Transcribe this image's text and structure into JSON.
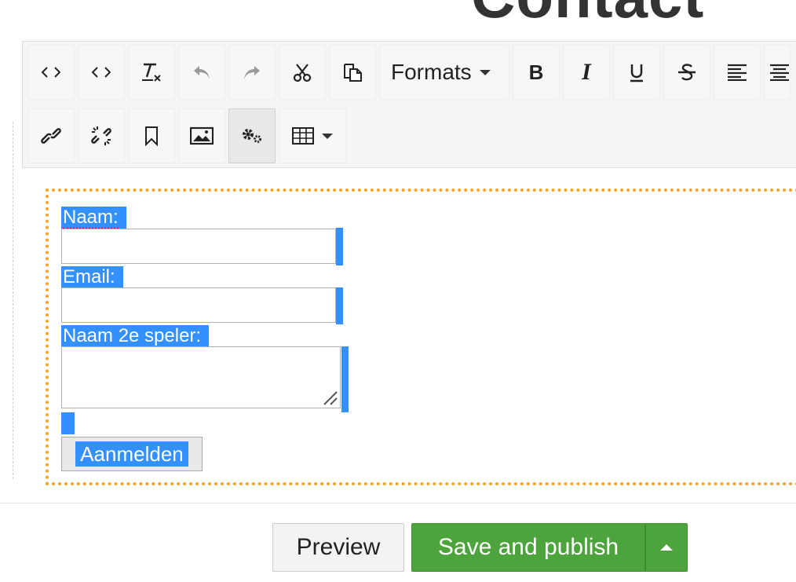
{
  "page": {
    "title": "Contact"
  },
  "toolbar": {
    "formats_label": "Formats",
    "row1": [
      {
        "name": "source-code-button",
        "icon": "code-icon"
      },
      {
        "name": "code-button",
        "icon": "code-icon"
      },
      {
        "name": "clear-formatting-button",
        "icon": "clear-format-icon"
      },
      {
        "name": "undo-button",
        "icon": "undo-icon"
      },
      {
        "name": "redo-button",
        "icon": "redo-icon"
      },
      {
        "name": "cut-button",
        "icon": "scissors-icon"
      },
      {
        "name": "paste-button",
        "icon": "paste-icon"
      },
      {
        "name": "formats-dropdown",
        "icon": "chevron-down-icon"
      },
      {
        "name": "bold-button",
        "icon": "bold-icon"
      },
      {
        "name": "italic-button",
        "icon": "italic-icon"
      },
      {
        "name": "underline-button",
        "icon": "underline-icon"
      },
      {
        "name": "strikethrough-button",
        "icon": "strikethrough-icon"
      },
      {
        "name": "align-left-button",
        "icon": "align-left-icon"
      },
      {
        "name": "align-center-button",
        "icon": "align-center-icon"
      }
    ],
    "row2": [
      {
        "name": "insert-link-button",
        "icon": "link-icon"
      },
      {
        "name": "remove-link-button",
        "icon": "unlink-icon"
      },
      {
        "name": "anchor-button",
        "icon": "bookmark-icon"
      },
      {
        "name": "insert-image-button",
        "icon": "image-icon"
      },
      {
        "name": "macro-button",
        "icon": "gears-icon"
      },
      {
        "name": "table-dropdown",
        "icon": "table-icon"
      }
    ]
  },
  "form": {
    "name_label": "Naam:",
    "email_label": "Email:",
    "player2_label": "Naam 2e speler:",
    "submit_label": "Aanmelden",
    "name_value": "",
    "email_value": "",
    "player2_value": ""
  },
  "footer": {
    "preview_label": "Preview",
    "save_label": "Save and publish"
  },
  "colors": {
    "selection": "#3390ff",
    "save_green": "#4ea43c",
    "editor_border": "#f5a623"
  }
}
